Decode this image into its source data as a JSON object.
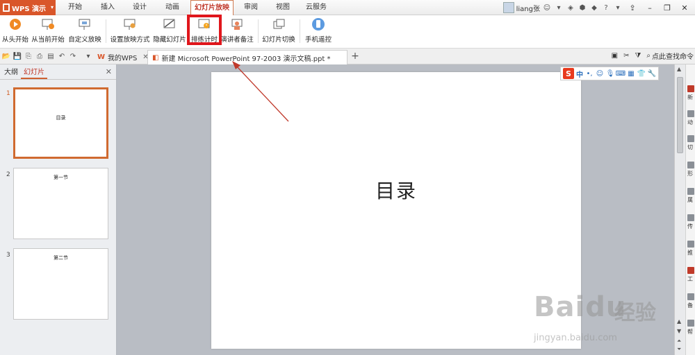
{
  "app": {
    "name": "WPS 演示",
    "menu_tabs": [
      "开始",
      "插入",
      "设计",
      "动画",
      "幻灯片放映",
      "审阅",
      "视图",
      "云服务"
    ],
    "active_menu": "幻灯片放映",
    "username": "liang张"
  },
  "ribbon": {
    "buttons": [
      {
        "label": "从头开始"
      },
      {
        "label": "从当前开始"
      },
      {
        "label": "自定义放映"
      },
      {
        "label": "设置放映方式"
      },
      {
        "label": "隐藏幻灯片"
      },
      {
        "label": "排练计时"
      },
      {
        "label": "演讲者备注"
      },
      {
        "label": "幻灯片切换"
      },
      {
        "label": "手机遥控"
      }
    ]
  },
  "tabs": {
    "home_tab": "我的WPS",
    "doc_tab": "新建 Microsoft PowerPoint 97-2003 演示文稿.ppt *",
    "search_label": "点此查找命令"
  },
  "left_panel": {
    "tab_outline": "大纲",
    "tab_slides": "幻灯片",
    "slides": [
      {
        "num": "1",
        "text": "目录"
      },
      {
        "num": "2",
        "text": "第一节"
      },
      {
        "num": "3",
        "text": "第二节"
      }
    ]
  },
  "slide": {
    "title": "目录"
  },
  "ime": {
    "logo": "S",
    "mode": "中"
  },
  "sidebar": {
    "items": [
      "新",
      "动",
      "切",
      "形",
      "属",
      "传",
      "推",
      "工",
      "备",
      "帮"
    ]
  },
  "watermark": {
    "brand": "Baidu",
    "cn": "经验",
    "url": "jingyan.baidu.com"
  },
  "colors": {
    "accent": "#d9562a",
    "highlight": "#e0161c",
    "annotation_arrow": "#c0392b"
  }
}
